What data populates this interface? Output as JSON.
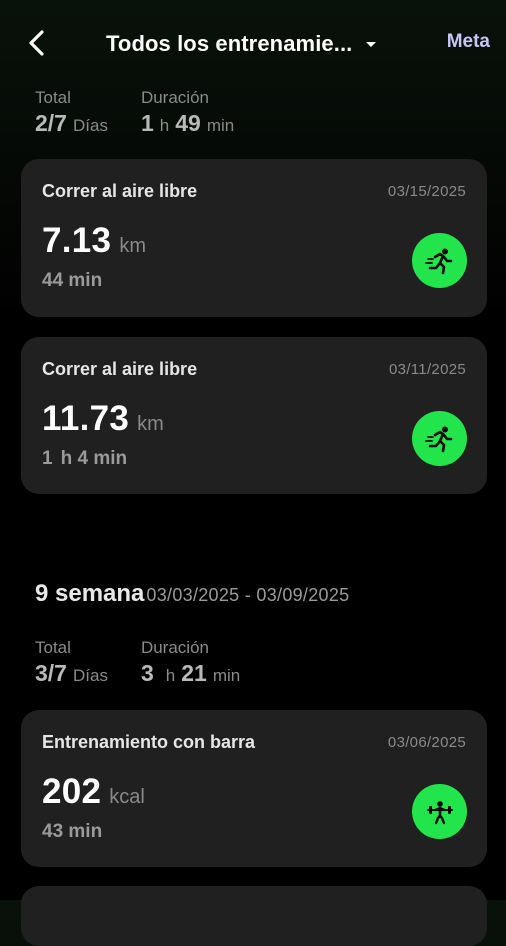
{
  "header": {
    "title": "Todos los entrenamie...",
    "goal_label": "Meta"
  },
  "colors": {
    "accent": "#22e54b",
    "card_bg": "#202020",
    "goal_link": "#c8c4f5"
  },
  "current_period": {
    "total_label": "Total",
    "total_value": "2/7",
    "total_unit": "Días",
    "duration_label": "Duración",
    "duration_hours": "1",
    "duration_hours_unit": "h",
    "duration_minutes": "49",
    "duration_minutes_unit": "min"
  },
  "workouts": [
    {
      "title": "Correr al aire libre",
      "date": "03/15/2025",
      "value": "7.13",
      "unit": "km",
      "duration": "44 min",
      "icon": "running-icon"
    },
    {
      "title": "Correr al aire libre",
      "date": "03/11/2025",
      "value": "11.73",
      "unit": "km",
      "duration_h": "1",
      "duration_h_unit": "h",
      "duration_m": "4",
      "duration_m_unit": "min",
      "icon": "running-icon"
    }
  ],
  "week9": {
    "title": "9 semana",
    "range": "03/03/2025 - 03/09/2025",
    "total_label": "Total",
    "total_value": "3/7",
    "total_unit": "Días",
    "duration_label": "Duración",
    "duration_hours": "3",
    "duration_hours_unit": "h",
    "duration_minutes": "21",
    "duration_minutes_unit": "min",
    "workouts": [
      {
        "title": "Entrenamiento con barra",
        "date": "03/06/2025",
        "value": "202",
        "unit": "kcal",
        "duration": "43 min",
        "icon": "barbell-icon"
      }
    ]
  }
}
